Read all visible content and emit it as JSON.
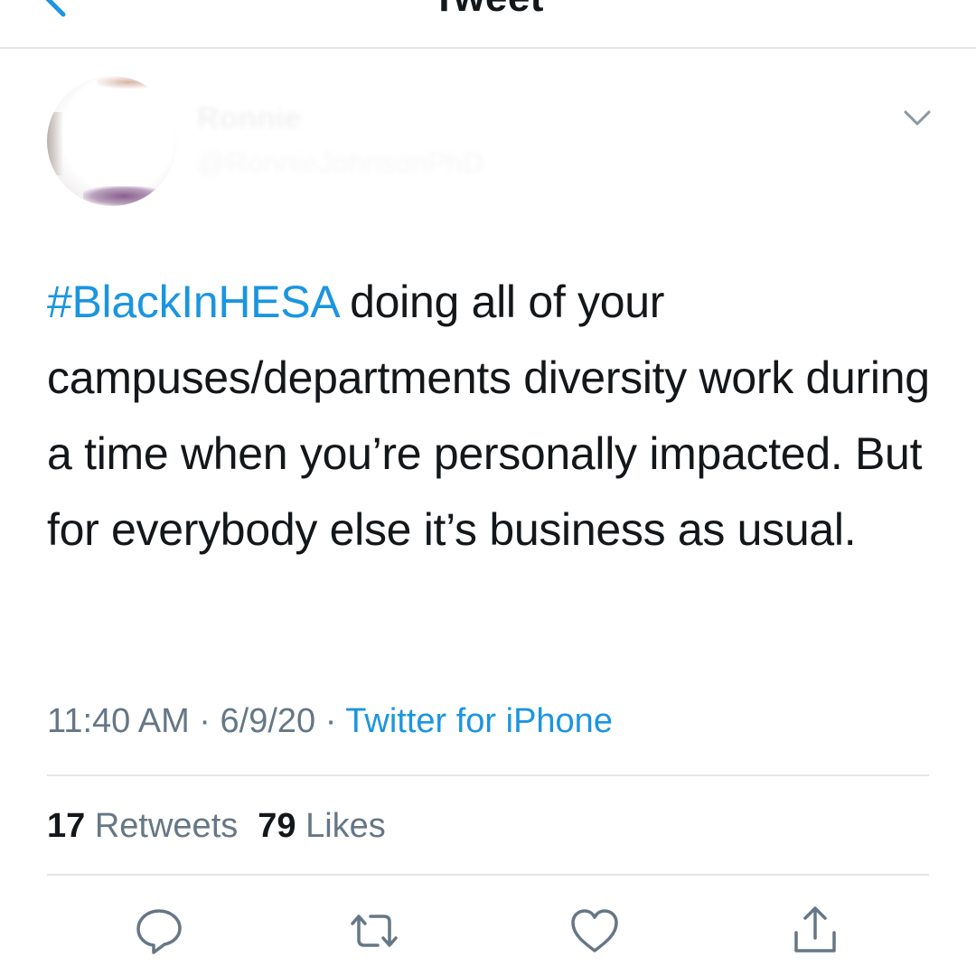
{
  "nav": {
    "title": "Tweet"
  },
  "author": {
    "name": "Ronnie",
    "handle": "@RonnieJohnsonPhD"
  },
  "tweet": {
    "hashtag": "#BlackInHESA",
    "body": " doing all of your campuses/departments diversity work during a time when you’re personally impacted. But for everybody else it’s business as usual."
  },
  "meta": {
    "time": "11:40 AM",
    "sep1": " · ",
    "date": "6/9/20",
    "sep2": " · ",
    "source": "Twitter for iPhone"
  },
  "stats": {
    "retweets_count": "17",
    "retweets_label": "Retweets",
    "likes_count": "79",
    "likes_label": "Likes"
  },
  "icons": {
    "back": "chevron-left-icon",
    "more": "chevron-down-icon",
    "reply": "reply-icon",
    "retweet": "retweet-icon",
    "like": "heart-icon",
    "share": "share-icon"
  },
  "colors": {
    "accent": "#1b95e0",
    "text": "#14171a",
    "secondary": "#657786",
    "divider": "#e3e5e8"
  }
}
